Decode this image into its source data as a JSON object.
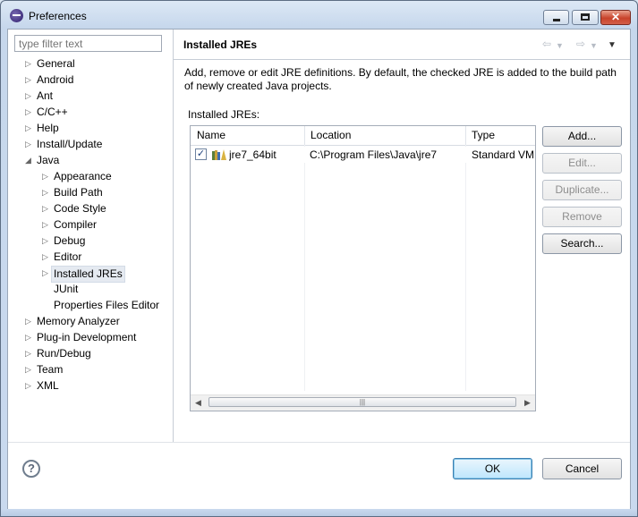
{
  "window": {
    "title": "Preferences",
    "controls": {
      "minimize_icon": "minimize-icon",
      "maximize_icon": "maximize-icon",
      "close_icon": "close-icon",
      "close_glyph": "✕"
    }
  },
  "sidebar": {
    "filter_placeholder": "type filter text",
    "items": [
      {
        "label": "General",
        "level": 0,
        "twisty": "collapsed"
      },
      {
        "label": "Android",
        "level": 0,
        "twisty": "collapsed"
      },
      {
        "label": "Ant",
        "level": 0,
        "twisty": "collapsed"
      },
      {
        "label": "C/C++",
        "level": 0,
        "twisty": "collapsed"
      },
      {
        "label": "Help",
        "level": 0,
        "twisty": "collapsed"
      },
      {
        "label": "Install/Update",
        "level": 0,
        "twisty": "collapsed"
      },
      {
        "label": "Java",
        "level": 0,
        "twisty": "expanded"
      },
      {
        "label": "Appearance",
        "level": 1,
        "twisty": "collapsed"
      },
      {
        "label": "Build Path",
        "level": 1,
        "twisty": "collapsed"
      },
      {
        "label": "Code Style",
        "level": 1,
        "twisty": "collapsed"
      },
      {
        "label": "Compiler",
        "level": 1,
        "twisty": "collapsed"
      },
      {
        "label": "Debug",
        "level": 1,
        "twisty": "collapsed"
      },
      {
        "label": "Editor",
        "level": 1,
        "twisty": "collapsed"
      },
      {
        "label": "Installed JREs",
        "level": 1,
        "twisty": "collapsed",
        "selected": true
      },
      {
        "label": "JUnit",
        "level": 1,
        "twisty": "none"
      },
      {
        "label": "Properties Files Editor",
        "level": 1,
        "twisty": "none"
      },
      {
        "label": "Memory Analyzer",
        "level": 0,
        "twisty": "collapsed"
      },
      {
        "label": "Plug-in Development",
        "level": 0,
        "twisty": "collapsed"
      },
      {
        "label": "Run/Debug",
        "level": 0,
        "twisty": "collapsed"
      },
      {
        "label": "Team",
        "level": 0,
        "twisty": "collapsed"
      },
      {
        "label": "XML",
        "level": 0,
        "twisty": "collapsed"
      }
    ]
  },
  "page": {
    "title": "Installed JREs",
    "nav": {
      "back_icon": "back-arrow-icon",
      "forward_icon": "forward-arrow-icon",
      "menu_icon": "view-menu-icon"
    },
    "description": "Add, remove or edit JRE definitions. By default, the checked JRE is added to the build path of newly created Java projects.",
    "list_label": "Installed JREs:",
    "table": {
      "columns": [
        "Name",
        "Location",
        "Type"
      ],
      "rows": [
        {
          "checked": true,
          "name": "jre7_64bit",
          "location": "C:\\Program Files\\Java\\jre7",
          "type": "Standard VM"
        }
      ]
    },
    "buttons": [
      {
        "label": "Add...",
        "enabled": true
      },
      {
        "label": "Edit...",
        "enabled": false
      },
      {
        "label": "Duplicate...",
        "enabled": false
      },
      {
        "label": "Remove",
        "enabled": false
      },
      {
        "label": "Search...",
        "enabled": true
      }
    ]
  },
  "footer": {
    "help_icon": "help-icon",
    "ok_label": "OK",
    "cancel_label": "Cancel"
  }
}
